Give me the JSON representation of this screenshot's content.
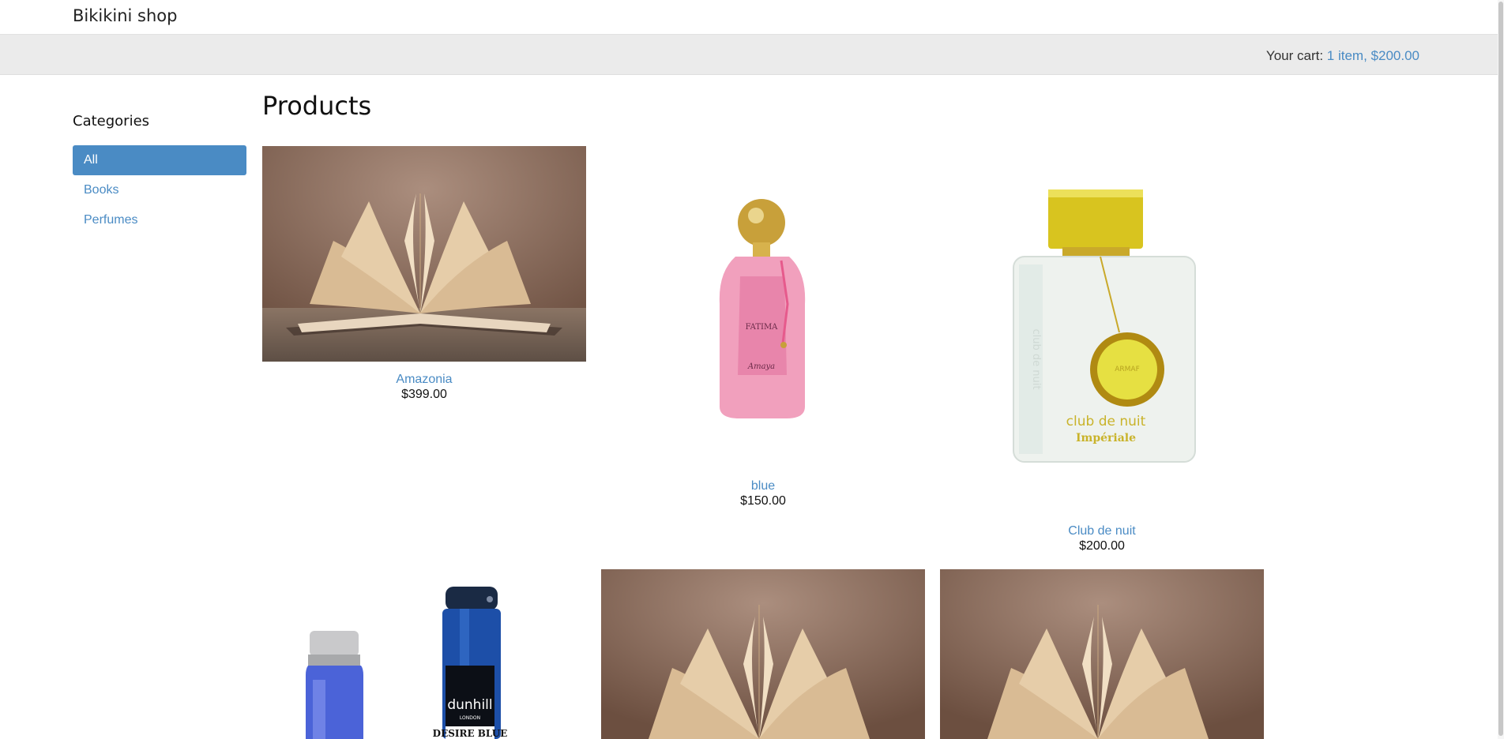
{
  "header": {
    "shop_title": "Bikikini shop"
  },
  "cart": {
    "label": "Your cart:",
    "summary": "1 item, $200.00"
  },
  "sidebar": {
    "title": "Categories",
    "items": [
      {
        "label": "All",
        "active": true
      },
      {
        "label": "Books",
        "active": false
      },
      {
        "label": "Perfumes",
        "active": false
      }
    ]
  },
  "main": {
    "title": "Products",
    "products": [
      {
        "name": "Amazonia",
        "price": "$399.00",
        "image": "open-book"
      },
      {
        "name": "blue",
        "price": "$150.00",
        "image": "pink-perfume-bottle"
      },
      {
        "name": "Club de nuit",
        "price": "$200.00",
        "image": "white-perfume-bottle"
      },
      {
        "name": "",
        "price": "",
        "image": "blue-perfume-and-spray"
      },
      {
        "name": "",
        "price": "",
        "image": "open-book"
      },
      {
        "name": "",
        "price": "",
        "image": "open-book"
      }
    ]
  },
  "image_text": {
    "pink_bottle": [
      "FATIMA",
      "Amaya"
    ],
    "white_bottle": [
      "club de nuit",
      "Impériale",
      "ARMAF",
      "club de nuit"
    ],
    "blue_spray": [
      "dunhill",
      "LONDON",
      "DESIRE BLUE"
    ]
  },
  "colors": {
    "accent": "#4a8bc4",
    "cart_bar": "#ebebeb"
  }
}
